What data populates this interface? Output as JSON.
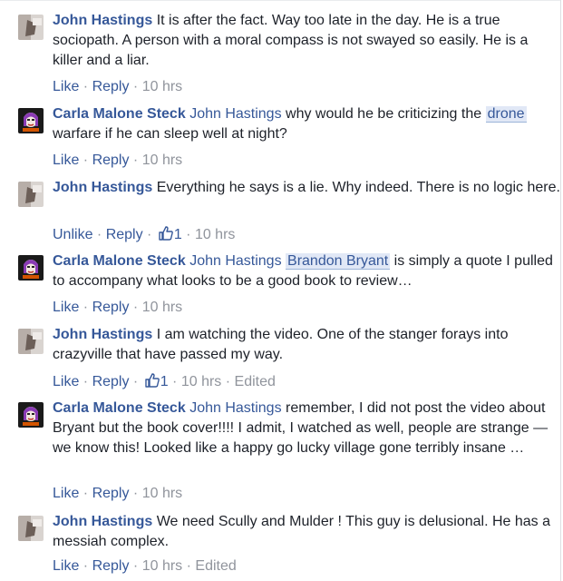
{
  "comments": [
    {
      "author": "John Hastings",
      "mention": "",
      "text": "It is after the fact. Way too late in the day. He is a true sociopath. A person with a moral compass is not swayed so easily. He is a killer and a liar.",
      "actions": {
        "like": "Like",
        "reply": "Reply",
        "time": "10 hrs"
      },
      "avatar": "john-avatar"
    },
    {
      "author": "Carla Malone Steck",
      "mention": "John Hastings",
      "text_pre": "why would he be criticizing the",
      "highlight": "drone",
      "text_post": "warfare if he can sleep well at night?",
      "actions": {
        "like": "Like",
        "reply": "Reply",
        "time": "10 hrs"
      },
      "avatar": "carla-avatar"
    },
    {
      "author": "John Hastings",
      "mention": "",
      "text": "Everything he says is a lie. Why indeed. There is no logic here.",
      "actions": {
        "like": "Unlike",
        "reply": "Reply",
        "likes": "1",
        "time": "10 hrs"
      },
      "avatar": "john-avatar"
    },
    {
      "author": "Carla Malone Steck",
      "mention": "John Hastings",
      "highlight": "Brandon Bryant",
      "text_post": "is simply a quote I pulled to accompany what looks to be a good book to review…",
      "actions": {
        "like": "Like",
        "reply": "Reply",
        "time": "10 hrs"
      },
      "avatar": "carla-avatar"
    },
    {
      "author": "John Hastings",
      "mention": "",
      "text": "I am watching the video. One of the stanger forays into crazyville that have passed my way.",
      "actions": {
        "like": "Like",
        "reply": "Reply",
        "likes": "1",
        "time": "10 hrs",
        "edited": "Edited"
      },
      "avatar": "john-avatar"
    },
    {
      "author": "Carla Malone Steck",
      "mention": "John Hastings",
      "text": "remember, I did not post the video about Bryant but the book cover!!!! I admit, I watched as well, people are strange —we know this! Looked like a happy go lucky village gone terribly insane …",
      "actions": {
        "like": "Like",
        "reply": "Reply",
        "time": "10 hrs"
      },
      "avatar": "carla-avatar"
    },
    {
      "author": "John Hastings",
      "mention": "",
      "text": "We need Scully and Mulder ! This guy is delusional. He has a messiah complex.",
      "actions": {
        "like": "Like",
        "reply": "Reply",
        "time": "10 hrs",
        "edited": "Edited"
      },
      "avatar": "john-avatar"
    }
  ],
  "colors": {
    "link": "#365899",
    "meta": "#90949c",
    "text": "#1d2129"
  },
  "icons": {
    "like_count": "thumbs-up-icon"
  }
}
